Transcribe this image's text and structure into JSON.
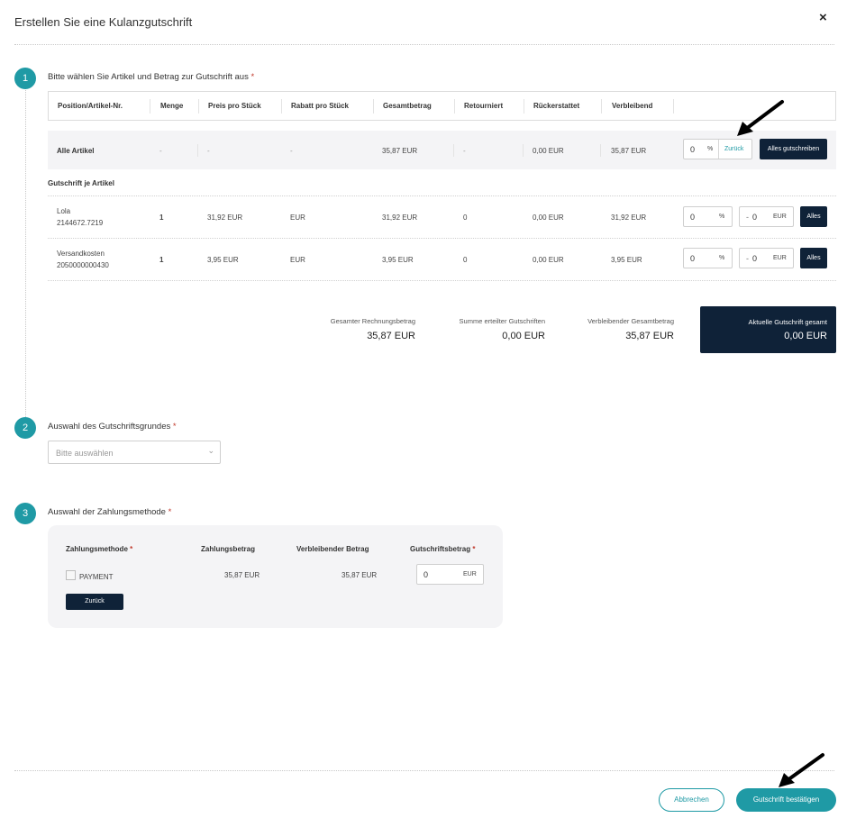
{
  "dialog": {
    "title": "Erstellen Sie eine Kulanzgutschrift",
    "close_icon": "×"
  },
  "step1": {
    "number": "1",
    "label": "Bitte wählen Sie Artikel und Betrag zur Gutschrift aus",
    "required": "*",
    "columns": [
      "Position/Artikel-Nr.",
      "Menge",
      "Preis pro Stück",
      "Rabatt pro Stück",
      "Gesamtbetrag",
      "Retourniert",
      "Rückerstattet",
      "Verbleibend"
    ],
    "all_row": {
      "name": "Alle Artikel",
      "menge": "-",
      "preis": "-",
      "rabatt": "-",
      "gesamt": "35,87 EUR",
      "retourniert": "-",
      "rueckerstattet": "0,00 EUR",
      "verbleibend": "35,87 EUR",
      "percent_value": "0",
      "percent_unit": "%",
      "zurueck": "Zurück",
      "alles_button": "Alles gutschreiben"
    },
    "sub_heading": "Gutschrift je Artikel",
    "rows": [
      {
        "name": "Lola",
        "nr": "2144672.7219",
        "menge": "1",
        "preis": "31,92 EUR",
        "rabatt": "EUR",
        "gesamt": "31,92 EUR",
        "retourniert": "0",
        "rueckerstattet": "0,00 EUR",
        "verbleibend": "31,92 EUR",
        "percent_value": "0",
        "percent_unit": "%",
        "amount_prefix": "-",
        "amount_value": "0",
        "amount_unit": "EUR",
        "alles": "Alles"
      },
      {
        "name": "Versandkosten",
        "nr": "2050000000430",
        "menge": "1",
        "preis": "3,95 EUR",
        "rabatt": "EUR",
        "gesamt": "3,95 EUR",
        "retourniert": "0",
        "rueckerstattet": "0,00 EUR",
        "verbleibend": "3,95 EUR",
        "percent_value": "0",
        "percent_unit": "%",
        "amount_prefix": "-",
        "amount_value": "0",
        "amount_unit": "EUR",
        "alles": "Alles"
      }
    ],
    "summary": {
      "rechnung_label": "Gesamter Rechnungsbetrag",
      "rechnung_value": "35,87 EUR",
      "erteilt_label": "Summe erteilter Gutschriften",
      "erteilt_value": "0,00 EUR",
      "verbleibend_label": "Verbleibender Gesamtbetrag",
      "verbleibend_value": "35,87 EUR",
      "aktuell_label": "Aktuelle Gutschrift gesamt",
      "aktuell_value": "0,00 EUR"
    }
  },
  "step2": {
    "number": "2",
    "label": "Auswahl des Gutschriftsgrundes",
    "required": "*",
    "select_placeholder": "Bitte auswählen",
    "chevron_icon": "⌄"
  },
  "step3": {
    "number": "3",
    "label": "Auswahl der Zahlungsmethode",
    "required": "*",
    "columns": {
      "methode": "Zahlungsmethode",
      "methode_req": "*",
      "betrag": "Zahlungsbetrag",
      "verbleibend": "Verbleibender Betrag",
      "gutschrift": "Gutschriftsbetrag",
      "gutschrift_req": "*"
    },
    "row": {
      "method": "PAYMENT",
      "betrag": "35,87 EUR",
      "verbleibend": "35,87 EUR",
      "input_value": "0",
      "input_unit": "EUR"
    },
    "zurueck_button": "Zurück"
  },
  "footer": {
    "cancel": "Abbrechen",
    "confirm": "Gutschrift bestätigen"
  },
  "colors": {
    "accent": "#1f9aa5",
    "dark": "#0f2238",
    "required": "#c0392b"
  },
  "annotations": {
    "arrow_icon": "arrow"
  }
}
